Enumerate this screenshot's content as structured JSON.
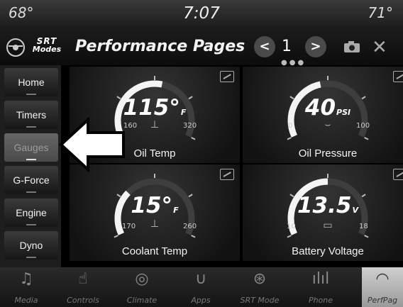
{
  "status_bar": {
    "temp_left": "68°",
    "clock": "7:07",
    "temp_right": "71°"
  },
  "title_bar": {
    "logo_top": "SRT",
    "logo_bottom": "Modes",
    "title": "Performance Pages",
    "page_prev": "<",
    "page_number": "1",
    "page_next": ">",
    "close": "✕"
  },
  "sidebar": {
    "items": [
      {
        "label": "Home"
      },
      {
        "label": "Timers"
      },
      {
        "label": "Gauges",
        "selected": true
      },
      {
        "label": "G-Force"
      },
      {
        "label": "Engine"
      },
      {
        "label": "Dyno"
      }
    ]
  },
  "gauges": [
    {
      "label": "Oil Temp",
      "value": "115°",
      "unit": "F",
      "min": "160",
      "max": "320",
      "level": 0.55
    },
    {
      "label": "Oil Pressure",
      "value": "40",
      "unit": "PSI",
      "min": "0",
      "max": "100",
      "level": 0.45
    },
    {
      "label": "Coolant Temp",
      "value": "15°",
      "unit": "F",
      "min": "170",
      "max": "260",
      "level": 0.3
    },
    {
      "label": "Battery Voltage",
      "value": "13.5",
      "unit": "V",
      "min": "10",
      "max": "18",
      "level": 0.5
    }
  ],
  "dock": {
    "items": [
      {
        "label": "Media",
        "icon": "music-note-icon"
      },
      {
        "label": "Controls",
        "icon": "hand-controls-icon"
      },
      {
        "label": "Climate",
        "icon": "climate-icon"
      },
      {
        "label": "Apps",
        "icon": "apps-icon"
      },
      {
        "label": "SRT Mode",
        "icon": "steering-wheel-icon"
      },
      {
        "label": "Phone",
        "icon": "phone-signal-icon"
      },
      {
        "label": "PerfPag",
        "icon": "gauge-icon",
        "selected": true
      }
    ]
  },
  "colors": {
    "accent_white": "#ffffff",
    "background": "#000000"
  }
}
